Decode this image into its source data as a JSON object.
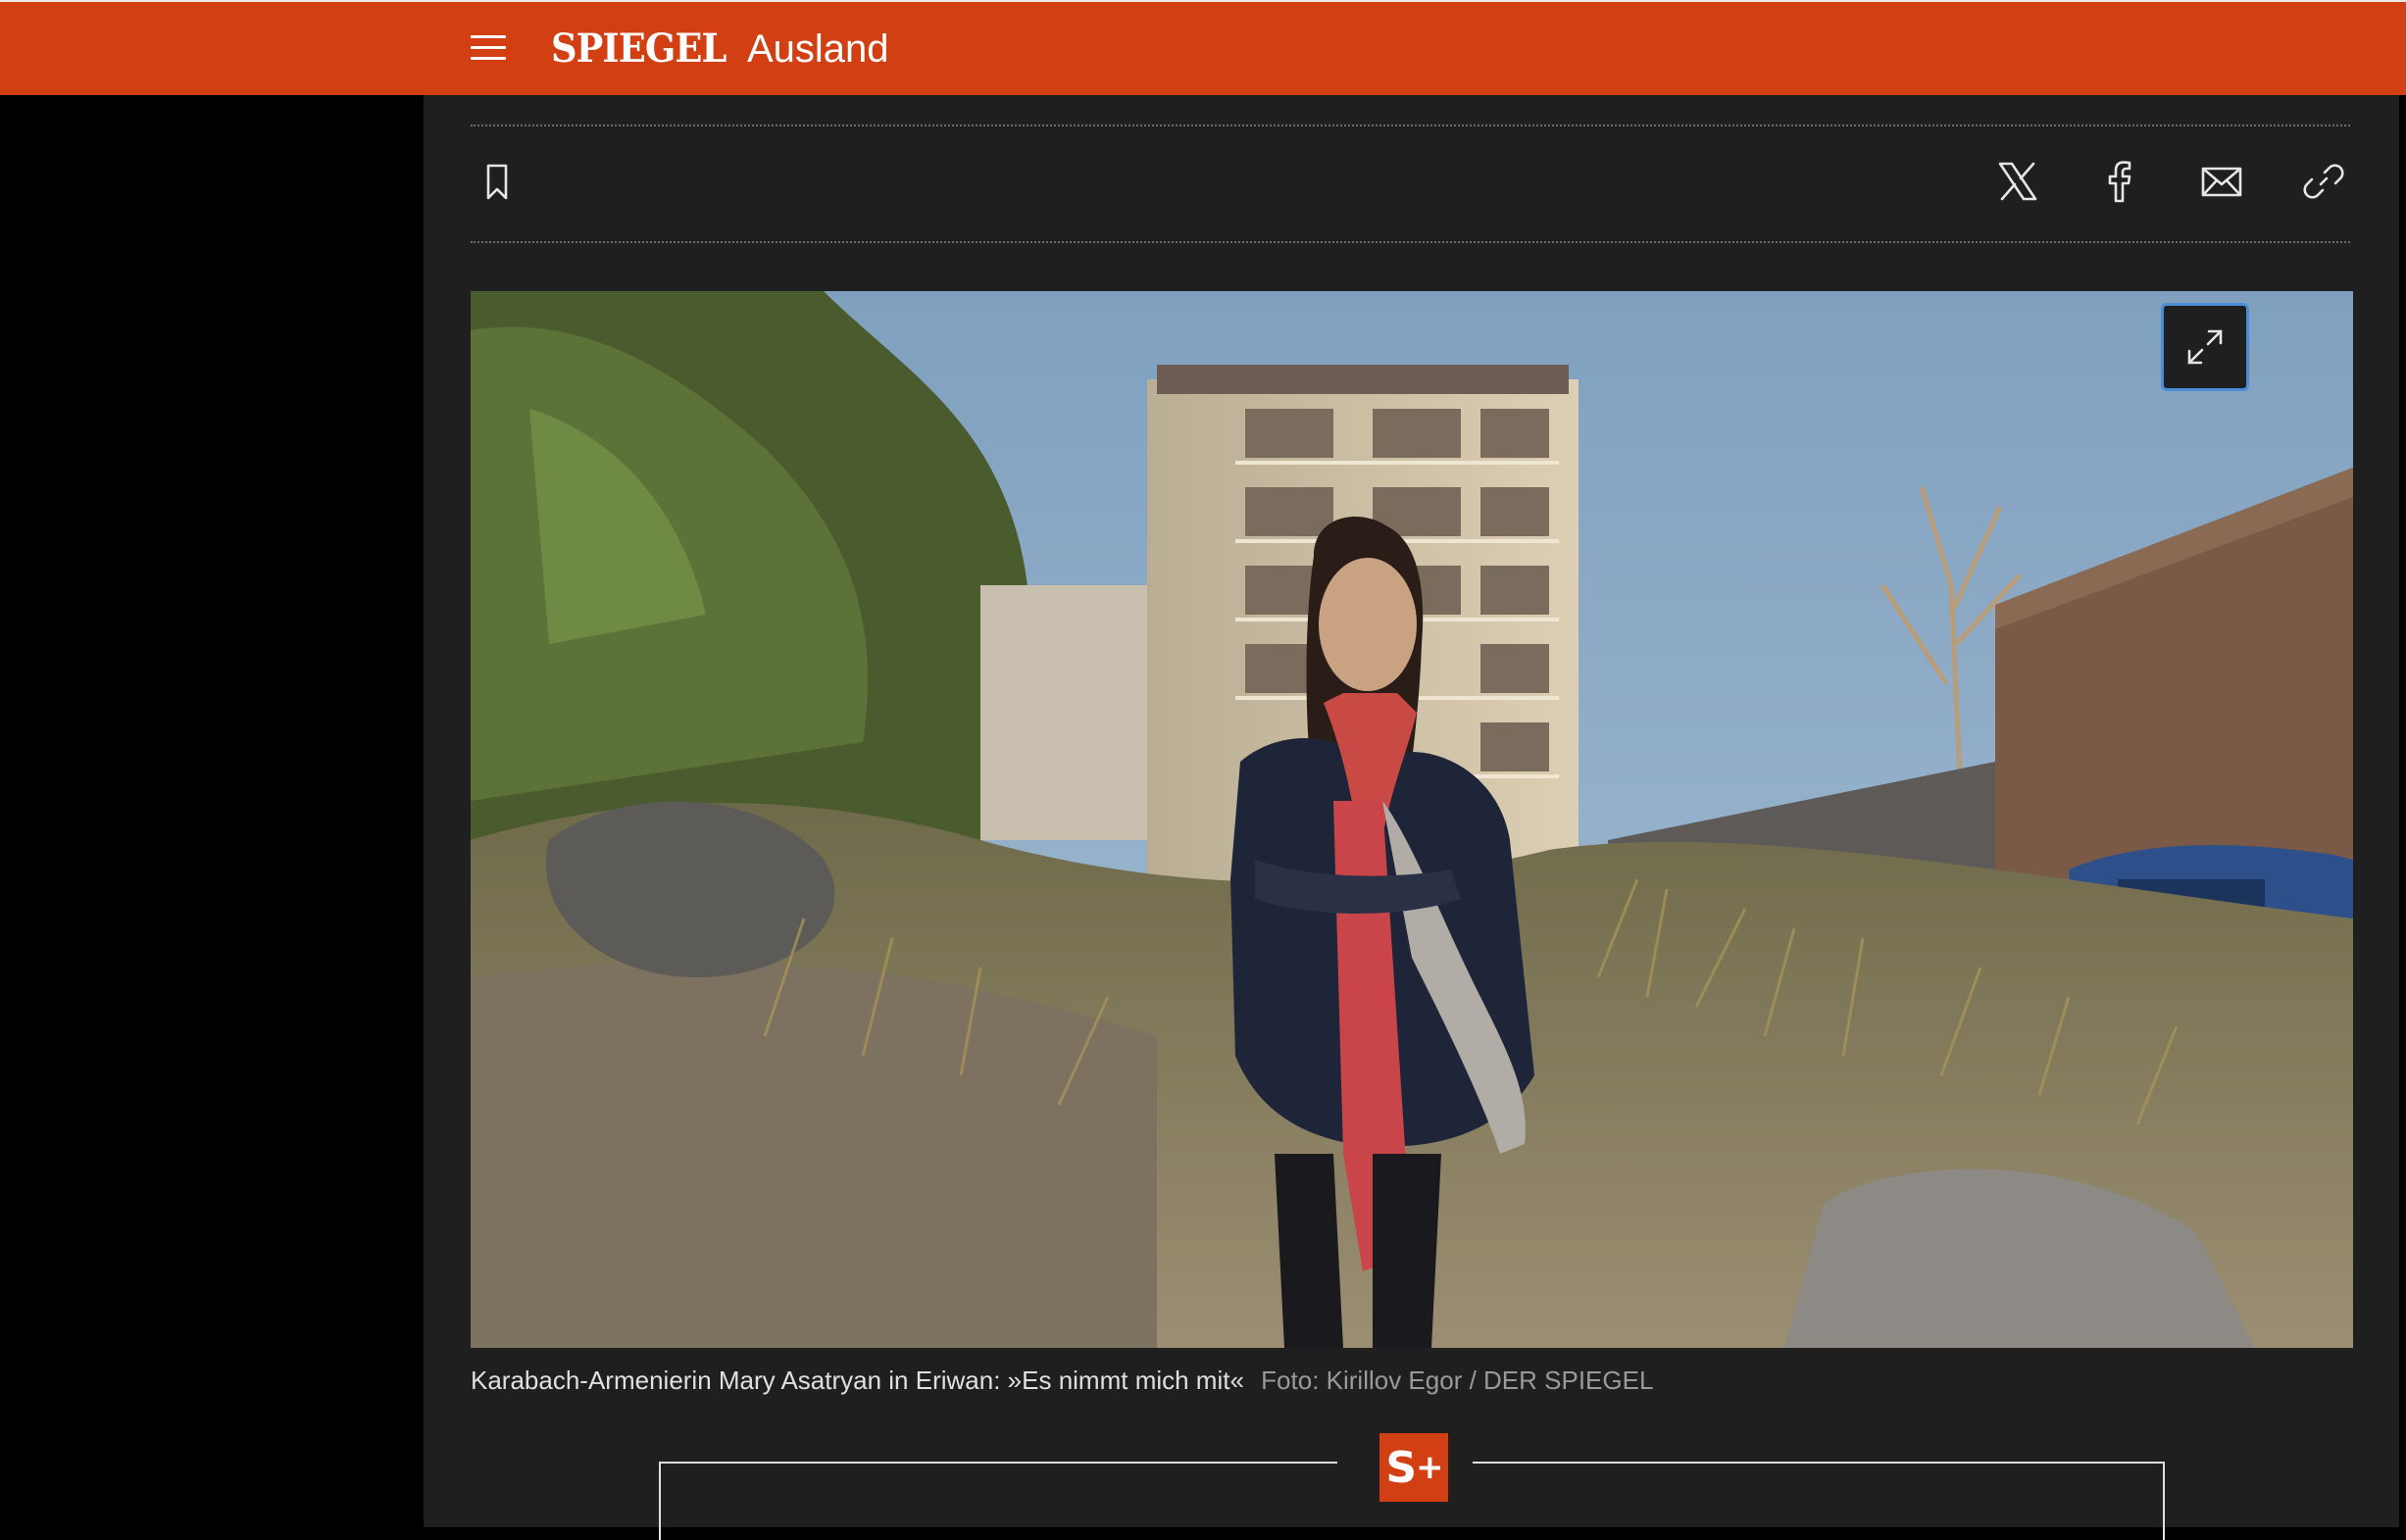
{
  "header": {
    "brand": "SPIEGEL",
    "section": "Ausland",
    "background_color": "#d13f12"
  },
  "toolbar": {
    "bookmark_icon": "bookmark-icon",
    "share_icons": [
      "x-twitter-icon",
      "facebook-icon",
      "mail-icon",
      "link-icon"
    ]
  },
  "figure": {
    "expand_icon": "expand-icon",
    "caption": "Karabach-Armenierin Mary Asatryan in Eriwan: »Es nimmt mich mit«",
    "credit": "Foto: Kirillov Egor / DER SPIEGEL"
  },
  "paywall": {
    "badge_letter": "S",
    "badge_plus": "+",
    "accent_color": "#d13f12"
  }
}
